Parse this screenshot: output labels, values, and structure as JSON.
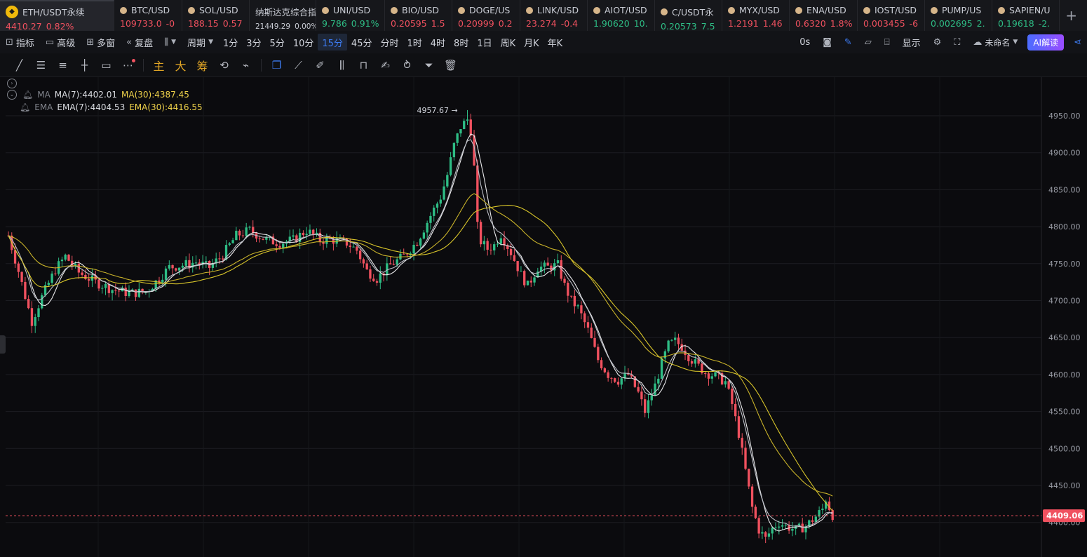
{
  "tickers": [
    {
      "name": "ETH/USDT永续",
      "price": "4410.27",
      "change": "0.82%",
      "dir": "red",
      "active": true,
      "w": 163
    },
    {
      "name": "BTC/USD",
      "price": "109733.0",
      "change": "-0",
      "dir": "red",
      "w": 97
    },
    {
      "name": "SOL/USD",
      "price": "188.15",
      "change": "0.57",
      "dir": "red",
      "w": 96
    },
    {
      "name": "纳斯达克综合指",
      "price": "21449.29",
      "change": "0.00%",
      "dir": "plain",
      "w": 95
    },
    {
      "name": "UNI/USD",
      "price": "9.786",
      "change": "0.91%",
      "dir": "green",
      "w": 98
    },
    {
      "name": "BIO/USD",
      "price": "0.20595",
      "change": "1.5",
      "dir": "red",
      "w": 96
    },
    {
      "name": "DOGE/US",
      "price": "0.20999",
      "change": "0.2",
      "dir": "red",
      "w": 97
    },
    {
      "name": "LINK/USD",
      "price": "23.274",
      "change": "-0.4",
      "dir": "red",
      "w": 96
    },
    {
      "name": "AIOT/USD",
      "price": "1.90620",
      "change": "10.",
      "dir": "green",
      "w": 96
    },
    {
      "name": "C/USDT永",
      "price": "0.20573",
      "change": "7.5",
      "dir": "green",
      "w": 96
    },
    {
      "name": "MYX/USD",
      "price": "1.2191",
      "change": "1.46",
      "dir": "red",
      "w": 96
    },
    {
      "name": "ENA/USD",
      "price": "0.6320",
      "change": "1.8%",
      "dir": "red",
      "w": 97
    },
    {
      "name": "IOST/USD",
      "price": "0.003455",
      "change": "-6",
      "dir": "red",
      "w": 96
    },
    {
      "name": "PUMP/US",
      "price": "0.002695",
      "change": "2.",
      "dir": "green",
      "w": 96
    },
    {
      "name": "SAPIEN/U",
      "price": "0.19618",
      "change": "-2.",
      "dir": "green",
      "w": 96
    }
  ],
  "toolbar": {
    "indicators": "指标",
    "advanced": "高级",
    "multi_window": "多窗",
    "replay": "复盘",
    "period": "周期",
    "periods": [
      "1分",
      "3分",
      "5分",
      "10分",
      "15分",
      "45分",
      "分时",
      "1时",
      "4时",
      "8时",
      "1日",
      "周K",
      "月K",
      "年K"
    ],
    "selected_period": "15分",
    "timer": "0s",
    "display": "显示",
    "layout_name": "未命名",
    "ai_button": "AI解读"
  },
  "drawing_tools": {
    "main": "主",
    "big": "大",
    "chips": "筹"
  },
  "legend": {
    "ma_label": "MA",
    "ma7": "MA(7):4402.01",
    "ma30": "MA(30):4387.45",
    "ema_label": "EMA",
    "ema7": "EMA(7):4404.53",
    "ema30": "EMA(30):4416.55"
  },
  "colors": {
    "up": "#2ebd85",
    "down": "#f0515f",
    "ma_short": "#e8e8ea",
    "ma_long": "#d9c62a"
  },
  "chart_data": {
    "type": "candlestick",
    "symbol": "ETH/USDT永续",
    "interval": "15分",
    "ylim": [
      4380,
      4985
    ],
    "y_ticks": [
      4400,
      4450,
      4500,
      4550,
      4600,
      4650,
      4700,
      4750,
      4800,
      4850,
      4900,
      4950
    ],
    "y_tick_labels": [
      "4400.00",
      "4450.00",
      "4500.00",
      "4550.00",
      "4600.00",
      "4650.00",
      "4700.00",
      "4750.00",
      "4800.00",
      "4850.00",
      "4900.00",
      "4950.00"
    ],
    "current_price": 4409.06,
    "current_price_label": "4409.06",
    "high_marker": 4957.67,
    "high_marker_label": "4957.67",
    "price_path": [
      [
        0,
        4788
      ],
      [
        3,
        4740
      ],
      [
        7,
        4672
      ],
      [
        10,
        4705
      ],
      [
        14,
        4742
      ],
      [
        17,
        4760
      ],
      [
        21,
        4738
      ],
      [
        26,
        4725
      ],
      [
        31,
        4715
      ],
      [
        36,
        4710
      ],
      [
        41,
        4712
      ],
      [
        45,
        4730
      ],
      [
        48,
        4745
      ],
      [
        52,
        4748
      ],
      [
        56,
        4752
      ],
      [
        60,
        4745
      ],
      [
        64,
        4762
      ],
      [
        68,
        4788
      ],
      [
        72,
        4795
      ],
      [
        77,
        4782
      ],
      [
        81,
        4778
      ],
      [
        85,
        4782
      ],
      [
        89,
        4795
      ],
      [
        93,
        4782
      ],
      [
        97,
        4782
      ],
      [
        101,
        4778
      ],
      [
        104,
        4768
      ],
      [
        107,
        4740
      ],
      [
        110,
        4730
      ],
      [
        114,
        4748
      ],
      [
        118,
        4760
      ],
      [
        122,
        4780
      ],
      [
        126,
        4815
      ],
      [
        129,
        4840
      ],
      [
        131,
        4870
      ],
      [
        133,
        4910
      ],
      [
        135,
        4935
      ],
      [
        137,
        4945
      ],
      [
        138,
        4930
      ],
      [
        139,
        4880
      ],
      [
        140,
        4800
      ],
      [
        141,
        4780
      ],
      [
        143,
        4770
      ],
      [
        145,
        4775
      ],
      [
        147,
        4790
      ],
      [
        150,
        4765
      ],
      [
        153,
        4735
      ],
      [
        155,
        4720
      ],
      [
        158,
        4745
      ],
      [
        161,
        4745
      ],
      [
        164,
        4748
      ],
      [
        166,
        4720
      ],
      [
        168,
        4700
      ],
      [
        170,
        4690
      ],
      [
        173,
        4660
      ],
      [
        176,
        4620
      ],
      [
        179,
        4600
      ],
      [
        182,
        4592
      ],
      [
        185,
        4600
      ],
      [
        188,
        4575
      ],
      [
        190,
        4550
      ],
      [
        193,
        4585
      ],
      [
        195,
        4615
      ],
      [
        197,
        4640
      ],
      [
        199,
        4645
      ],
      [
        201,
        4638
      ],
      [
        203,
        4625
      ],
      [
        205,
        4615
      ],
      [
        208,
        4603
      ],
      [
        211,
        4598
      ],
      [
        214,
        4590
      ],
      [
        216,
        4560
      ],
      [
        218,
        4520
      ],
      [
        220,
        4470
      ],
      [
        222,
        4420
      ],
      [
        224,
        4390
      ],
      [
        226,
        4378
      ],
      [
        228,
        4392
      ],
      [
        230,
        4400
      ],
      [
        232,
        4395
      ],
      [
        235,
        4390
      ],
      [
        238,
        4395
      ],
      [
        241,
        4408
      ],
      [
        243,
        4418
      ],
      [
        244,
        4432
      ],
      [
        245,
        4420
      ],
      [
        246,
        4410
      ]
    ]
  }
}
